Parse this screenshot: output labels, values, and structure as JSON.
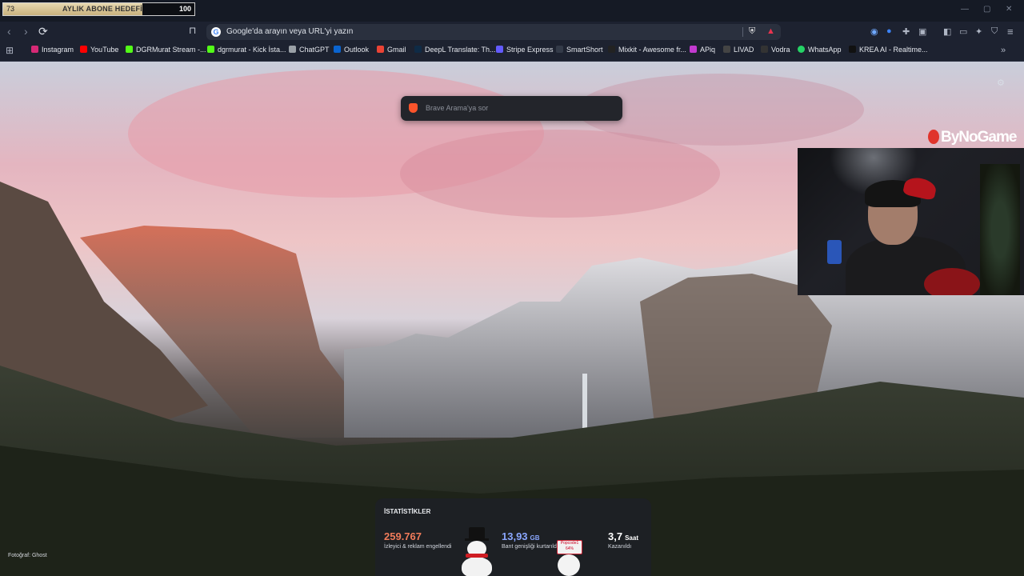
{
  "stream_goal": {
    "current": "73",
    "title": "AYLIK ABONE HEDEFİ",
    "target": "100",
    "progress": 0.73
  },
  "window_controls": {
    "minimize": "—",
    "maximize": "▢",
    "close": "✕"
  },
  "nav": {
    "back": "‹",
    "forward": "›",
    "reload": "⟳",
    "bookmark": "⊓"
  },
  "address_bar": {
    "placeholder": "Google'da arayın veya URL'yi yazın",
    "engine_icon": "G"
  },
  "bookmarks": [
    {
      "label": "Instagram",
      "color": "#d62976"
    },
    {
      "label": "YouTube",
      "color": "#ff0000"
    },
    {
      "label": "DGRMurat Stream -...",
      "color": "#53fc18"
    },
    {
      "label": "dgrmurat - Kick İsta...",
      "color": "#53fc18"
    },
    {
      "label": "ChatGPT",
      "color": "#9aa0a6"
    },
    {
      "label": "Outlook",
      "color": "#0a64d0"
    },
    {
      "label": "Gmail",
      "color": "#ea4335"
    },
    {
      "label": "DeepL Translate: Th...",
      "color": "#0f2b46"
    },
    {
      "label": "Stripe Express",
      "color": "#635bff"
    },
    {
      "label": "SmartShort",
      "color": "#333a48"
    },
    {
      "label": "Mixkit - Awesome fr...",
      "color": "#222"
    },
    {
      "label": "APiq",
      "color": "#c23ad0"
    },
    {
      "label": "LIVAD",
      "color": "#444"
    },
    {
      "label": "Vodra",
      "color": "#333"
    },
    {
      "label": "WhatsApp",
      "color": "#25d366"
    },
    {
      "label": "KREA AI - Realtime...",
      "color": "#111"
    }
  ],
  "new_tab": {
    "search_placeholder": "Brave Arama'ya sor",
    "brand_overlay": "ByNoGame",
    "photo_credit": "Fotoğraf: Ghost",
    "stats": {
      "title": "İSTATİSTİKLER",
      "items": [
        {
          "value": "259.767",
          "unit": "",
          "caption": "İzleyici & reklam engellendi",
          "color": "#f07b5a"
        },
        {
          "value": "13,93",
          "unit": "GB",
          "caption": "Bant genişliği kurtarıldı",
          "color": "#8aa7ff"
        },
        {
          "value": "3,7",
          "unit": "Saat",
          "caption": "Kazanıldı",
          "color": "#ffffff"
        }
      ],
      "tag_text": "Popcode1 64%"
    }
  }
}
